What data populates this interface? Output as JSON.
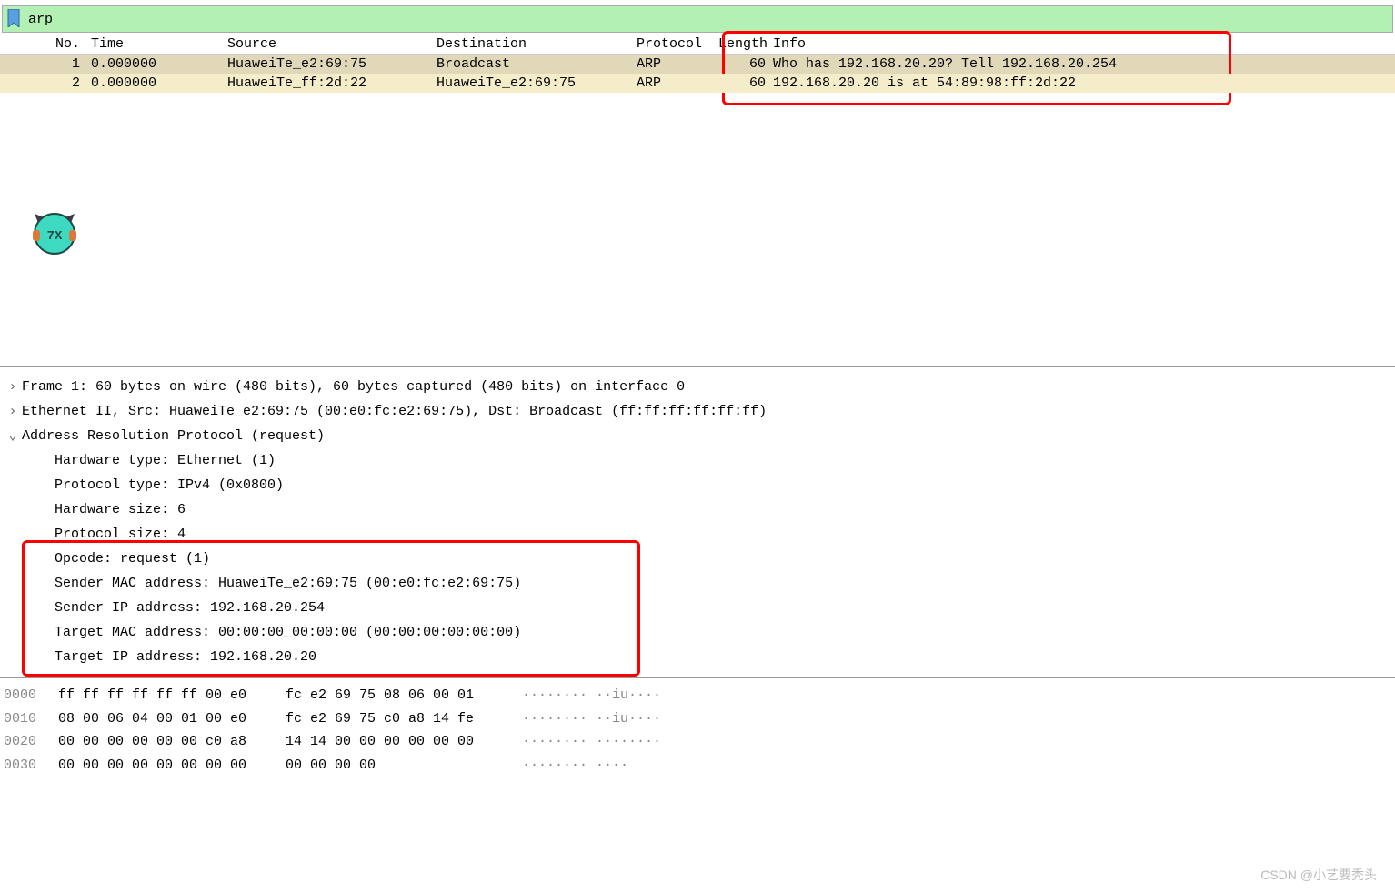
{
  "filter": {
    "value": "arp"
  },
  "columns": {
    "no": "No.",
    "time": "Time",
    "source": "Source",
    "destination": "Destination",
    "protocol": "Protocol",
    "length": "Length",
    "info": "Info"
  },
  "packets": [
    {
      "no": "1",
      "time": "0.000000",
      "src": "HuaweiTe_e2:69:75",
      "dst": "Broadcast",
      "proto": "ARP",
      "len": "60",
      "info": "Who has 192.168.20.20? Tell 192.168.20.254"
    },
    {
      "no": "2",
      "time": "0.000000",
      "src": "HuaweiTe_ff:2d:22",
      "dst": "HuaweiTe_e2:69:75",
      "proto": "ARP",
      "len": "60",
      "info": "192.168.20.20 is at 54:89:98:ff:2d:22"
    }
  ],
  "details": {
    "frame": "Frame 1: 60 bytes on wire (480 bits), 60 bytes captured (480 bits) on interface 0",
    "eth": "Ethernet II, Src: HuaweiTe_e2:69:75 (00:e0:fc:e2:69:75), Dst: Broadcast (ff:ff:ff:ff:ff:ff)",
    "arp_header": "Address Resolution Protocol (request)",
    "arp": {
      "hwtype": "Hardware type: Ethernet (1)",
      "ptype": "Protocol type: IPv4 (0x0800)",
      "hwsize": "Hardware size: 6",
      "psize": "Protocol size: 4",
      "opcode": "Opcode: request (1)",
      "smac": "Sender MAC address: HuaweiTe_e2:69:75 (00:e0:fc:e2:69:75)",
      "sip": "Sender IP address: 192.168.20.254",
      "tmac": "Target MAC address: 00:00:00_00:00:00 (00:00:00:00:00:00)",
      "tip": "Target IP address: 192.168.20.20"
    }
  },
  "hex": [
    {
      "off": "0000",
      "b1": "ff ff ff ff ff ff 00 e0",
      "b2": "fc e2 69 75 08 06 00 01",
      "asc": "········ ··iu····"
    },
    {
      "off": "0010",
      "b1": "08 00 06 04 00 01 00 e0",
      "b2": "fc e2 69 75 c0 a8 14 fe",
      "asc": "········ ··iu····"
    },
    {
      "off": "0020",
      "b1": "00 00 00 00 00 00 c0 a8",
      "b2": "14 14 00 00 00 00 00 00",
      "asc": "········ ········"
    },
    {
      "off": "0030",
      "b1": "00 00 00 00 00 00 00 00",
      "b2": "00 00 00 00",
      "asc": "········ ····"
    }
  ],
  "watermark": "CSDN @小艺要秃头"
}
